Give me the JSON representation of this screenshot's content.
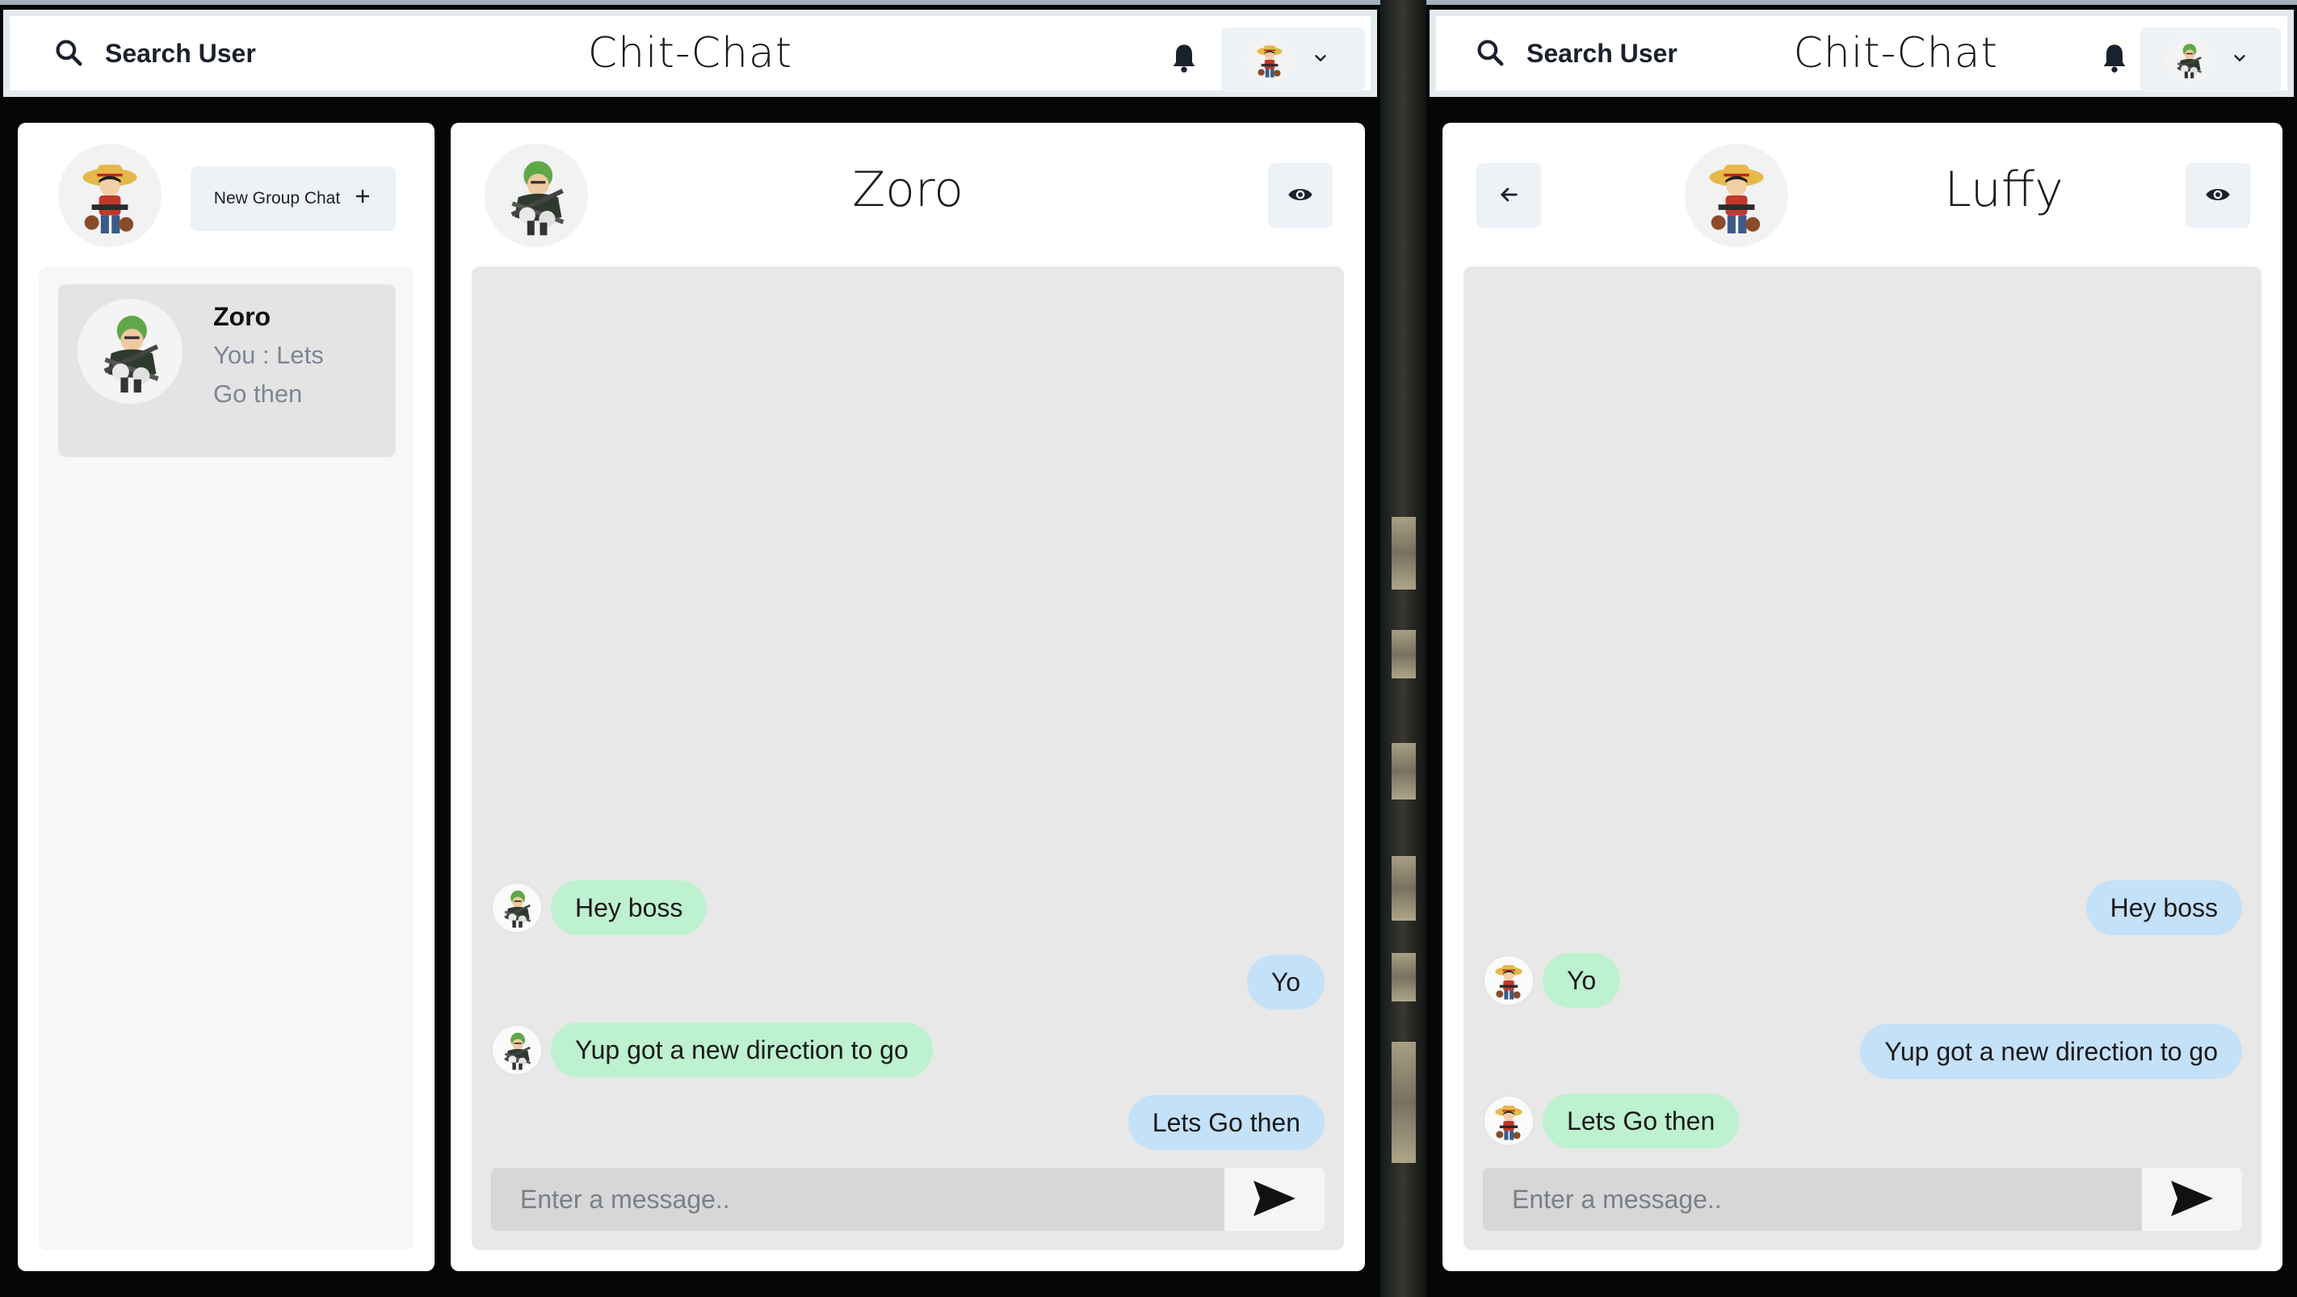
{
  "left_window": {
    "topbar": {
      "search_label": "Search User",
      "app_title": "Chit-Chat"
    },
    "sidebar": {
      "new_group_label": "New Group Chat",
      "chats": [
        {
          "name": "Zoro",
          "preview": "You : Lets Go then"
        }
      ]
    },
    "chat": {
      "title": "Zoro",
      "messages": [
        {
          "text": "Hey boss",
          "side": "left",
          "color": "green"
        },
        {
          "text": "Yo",
          "side": "right",
          "color": "blue"
        },
        {
          "text": "Yup got a new direction to go",
          "side": "left",
          "color": "green"
        },
        {
          "text": "Lets Go then",
          "side": "right",
          "color": "blue"
        }
      ],
      "input_placeholder": "Enter a message.."
    }
  },
  "right_window": {
    "topbar": {
      "search_label": "Search User",
      "app_title": "Chit-Chat"
    },
    "chat": {
      "title": "Luffy",
      "messages": [
        {
          "text": "Hey boss",
          "side": "right",
          "color": "blue"
        },
        {
          "text": "Yo",
          "side": "left",
          "color": "green"
        },
        {
          "text": "Yup got a new direction to go",
          "side": "right",
          "color": "blue"
        },
        {
          "text": "Lets Go then",
          "side": "left",
          "color": "green"
        }
      ],
      "input_placeholder": "Enter a message.."
    }
  },
  "icons": {
    "search": "search-icon",
    "bell": "bell-icon",
    "chevron": "chevron-down-icon",
    "eye": "eye-icon",
    "back": "arrow-left-icon",
    "send": "send-icon",
    "plus": "plus-icon"
  },
  "colors": {
    "sent_bubble": "#c3e1f9",
    "received_bubble": "#bdf1cf",
    "messages_bg": "#e8e8e8",
    "button_bg": "#edf2f7"
  }
}
